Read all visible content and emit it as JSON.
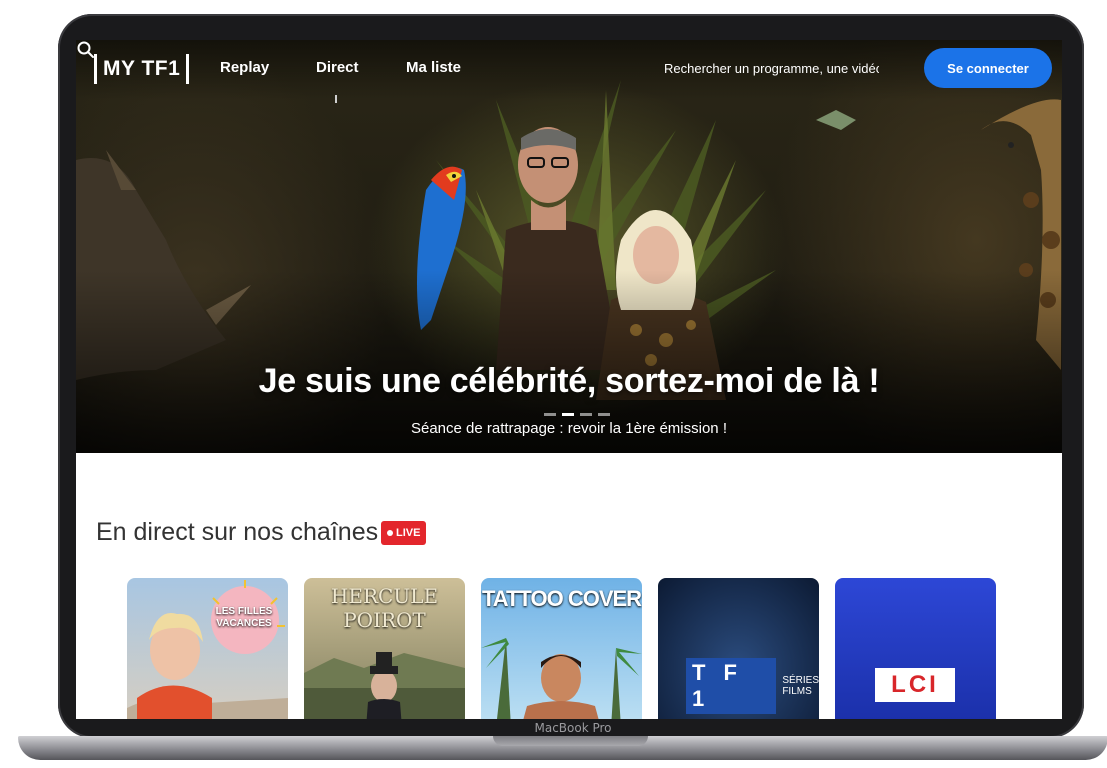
{
  "device": {
    "model_label": "MacBook Pro"
  },
  "nav": {
    "logo": "MY TF1",
    "links": [
      "Replay",
      "Direct",
      "Ma liste"
    ],
    "search_placeholder": "Rechercher un programme, une vidéo...",
    "login_label": "Se connecter"
  },
  "hero": {
    "title": "Je suis une célébrité, sortez-moi de là !",
    "subtitle": "Séance de rattrapage : revoir la 1ère émission !",
    "carousel_count": 4,
    "carousel_active": 1
  },
  "live_section": {
    "title": "En direct sur nos chaînes",
    "badge": "LIVE",
    "channels": [
      {
        "artwork_text": "LES FILLES VACANCES",
        "art_lines": [
          "LES FILLES",
          "VACANCES"
        ]
      },
      {
        "artwork_text": "HERCULE POIROT",
        "art_lines": [
          "HERCULE",
          "POIROT"
        ]
      },
      {
        "artwork_text": "TATTOO COVER",
        "art_lines": [
          "TATTOO COVER"
        ]
      },
      {
        "artwork_text": "TF1 SÉRIES FILMS",
        "logo": "T F 1",
        "sub_lines": [
          "SÉRIES",
          "FILMS"
        ]
      },
      {
        "artwork_text": "LCI",
        "logo": "LCI"
      }
    ]
  },
  "colors": {
    "accent_blue": "#1b73e8",
    "live_red": "#e3262c",
    "tf1_blue": "#1f4ea8",
    "lci_blue": "#1d3fc4"
  }
}
